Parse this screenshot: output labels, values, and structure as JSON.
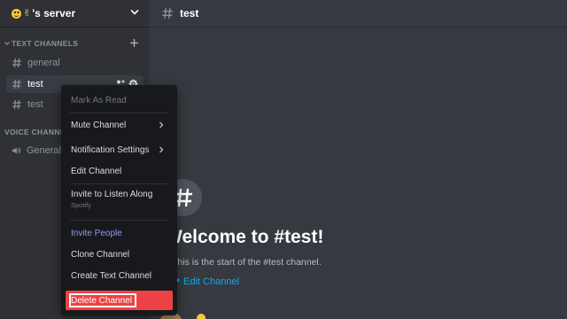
{
  "server": {
    "name": "'s server",
    "emoji_hand": "✌"
  },
  "sidebar": {
    "text_category": "TEXT CHANNELS",
    "voice_category": "VOICE CHANNELS",
    "channels": [
      {
        "name": "general"
      },
      {
        "name": "test"
      },
      {
        "name": "test"
      }
    ],
    "voice_channels": [
      {
        "name": "General"
      }
    ]
  },
  "topbar": {
    "channel_name": "test"
  },
  "welcome": {
    "title": "Welcome to #test!",
    "subtitle": "This is the start of the #test channel.",
    "edit_label": "Edit Channel"
  },
  "context_menu": {
    "mark_as_read": "Mark As Read",
    "mute_channel": "Mute Channel",
    "notification_settings": "Notification Settings",
    "edit_channel": "Edit Channel",
    "invite_to_listen": "Invite to Listen Along",
    "invite_to_listen_sub": "Spotify",
    "invite_people": "Invite People",
    "clone_channel": "Clone Channel",
    "create_text_channel": "Create Text Channel",
    "delete_channel": "Delete Channel"
  },
  "colors": {
    "danger": "#ed4245",
    "brand": "#8e9bf8",
    "link": "#00aff4",
    "sidebar_bg": "#2f3136",
    "main_bg": "#36393f",
    "menu_bg": "#18191c"
  }
}
